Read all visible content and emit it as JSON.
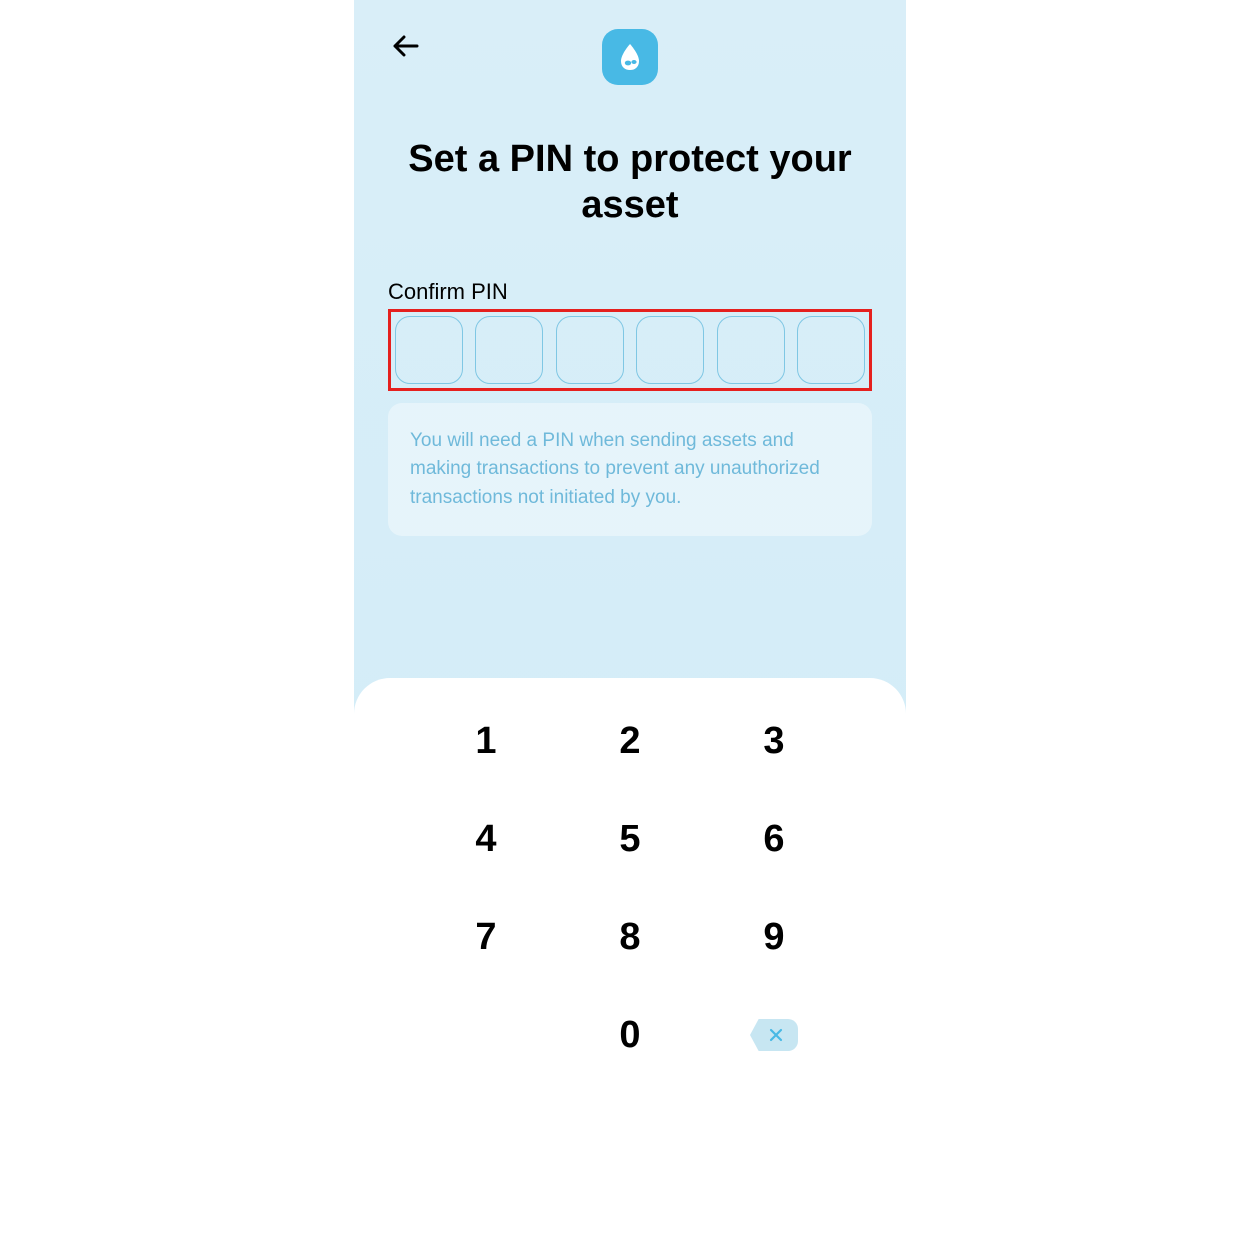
{
  "header": {
    "back_aria": "Back"
  },
  "title": "Set a PIN to protect your asset",
  "pin": {
    "label": "Confirm PIN",
    "length": 6
  },
  "info": {
    "text": "You will need a PIN when sending assets and making transactions to prevent any unauthorized transactions not initiated by you."
  },
  "keypad": {
    "keys": [
      "1",
      "2",
      "3",
      "4",
      "5",
      "6",
      "7",
      "8",
      "9",
      "",
      "0",
      "⌫"
    ]
  },
  "colors": {
    "accent": "#48b9e5",
    "highlight": "#e5201e",
    "pinBorder": "#7fc7e4",
    "infoText": "#6fb9da"
  }
}
